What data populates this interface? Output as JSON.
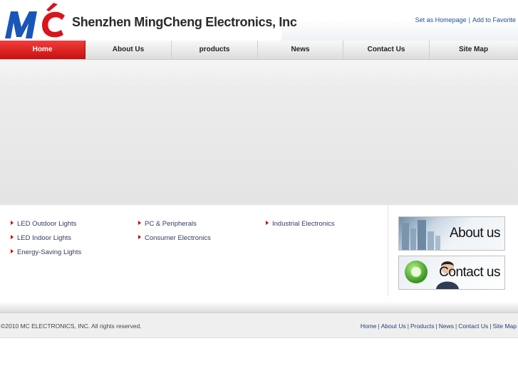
{
  "header": {
    "logo_text": "MC",
    "company_name": "Shenzhen MingCheng Electronics, Inc",
    "top_links": [
      "Set as Homepage",
      "Add to Favorite"
    ]
  },
  "nav": {
    "items": [
      "Home",
      "About Us",
      "products",
      "News",
      "Contact Us",
      "Site Map"
    ],
    "active": "Home"
  },
  "categories": {
    "col1": [
      "LED Outdoor Lights",
      "LED Indoor Lights",
      "Energy-Saving Lights"
    ],
    "col2": [
      "PC & Peripherals",
      "Consumer Electronics"
    ],
    "col3": [
      "Industrial Electronics"
    ]
  },
  "promos": {
    "about": "About us",
    "contact": "Contact us"
  },
  "footer": {
    "copyright": "©2010 MC ELECTRONICS, INC. All rights reserved.",
    "links": [
      "Home",
      "About Us",
      "Products",
      "News",
      "Contact Us",
      "Site Map"
    ]
  },
  "colors": {
    "brand_blue": "#1a56b8",
    "brand_red": "#d9141b",
    "nav_active": "#d41515",
    "link_blue": "#1f4f8c"
  }
}
